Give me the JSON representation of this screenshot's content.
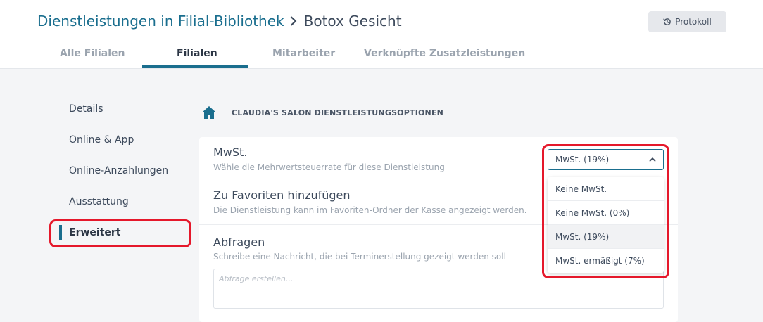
{
  "header": {
    "breadcrumb_link": "Dienstleistungen in Filial-Bibliothek",
    "breadcrumb_current": "Botox Gesicht",
    "protokoll_label": "Protokoll"
  },
  "tabs": [
    {
      "label": "Alle Filialen"
    },
    {
      "label": "Filialen"
    },
    {
      "label": "Mitarbeiter"
    },
    {
      "label": "Verknüpfte Zusatzleistungen"
    }
  ],
  "sidebar": {
    "items": [
      {
        "label": "Details"
      },
      {
        "label": "Online & App"
      },
      {
        "label": "Online-Anzahlungen"
      },
      {
        "label": "Ausstattung"
      },
      {
        "label": "Erweitert"
      }
    ]
  },
  "section": {
    "title": "CLAUDIA'S SALON DIENSTLEISTUNGSOPTIONEN"
  },
  "rows": {
    "mwst": {
      "title": "MwSt.",
      "desc": "Wähle die Mehrwertsteuerrate für diese Dienstleistung"
    },
    "favoriten": {
      "title": "Zu Favoriten hinzufügen",
      "desc": "Die Dienstleistung kann im Favoriten-Ordner der Kasse angezeigt werden."
    },
    "abfragen": {
      "title": "Abfragen",
      "desc": "Schreibe eine Nachricht, die bei Terminerstellung gezeigt werden soll",
      "placeholder": "Abfrage erstellen..."
    }
  },
  "select": {
    "value": "MwSt. (19%)",
    "options": [
      {
        "label": "Keine MwSt."
      },
      {
        "label": "Keine MwSt. (0%)"
      },
      {
        "label": "MwSt. (19%)"
      },
      {
        "label": "MwSt. ermäßigt (7%)"
      }
    ]
  },
  "colors": {
    "accent": "#1a6e8e",
    "highlight": "#e5182b"
  },
  "icons": [
    "history-icon",
    "chevron-right-icon",
    "home-icon",
    "chevron-up-icon"
  ]
}
